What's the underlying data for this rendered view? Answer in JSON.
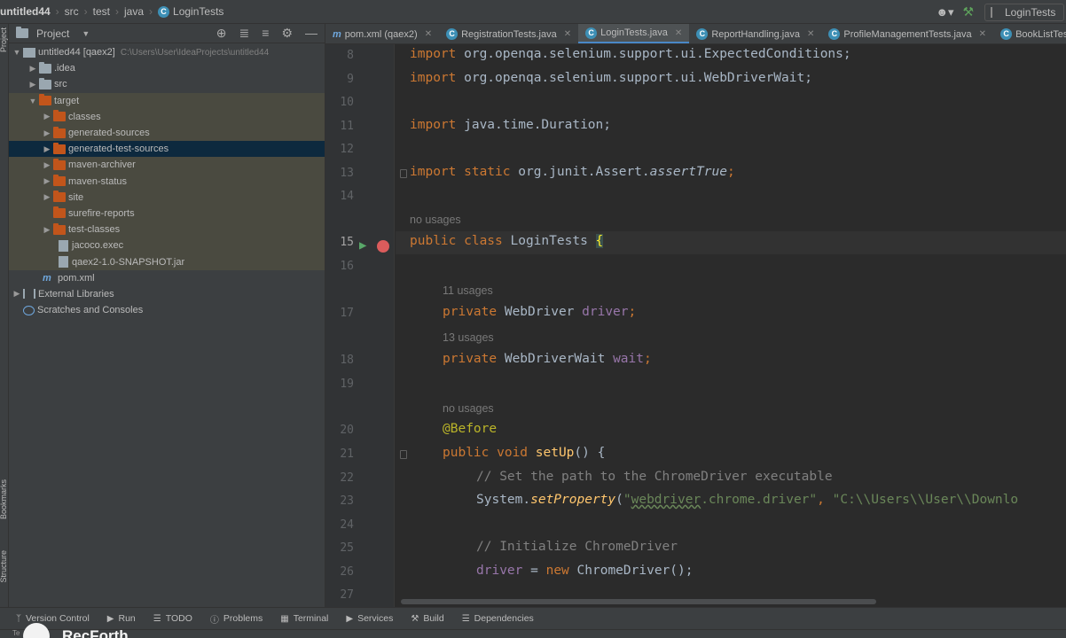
{
  "navbar": {
    "breadcrumbs": [
      "untitled44",
      "src",
      "test",
      "java",
      "LoginTests"
    ],
    "run_config": "LoginTests"
  },
  "toolstrip": {
    "top_label": "Project",
    "mid_label": "Bookmarks",
    "low_label": "Structure"
  },
  "project_panel": {
    "title": "Project",
    "tree": [
      {
        "label": "untitled44 [qaex2]",
        "note": "C:\\Users\\User\\IdeaProjects\\untitled44"
      },
      {
        "label": ".idea"
      },
      {
        "label": "src"
      },
      {
        "label": "target"
      },
      {
        "label": "classes"
      },
      {
        "label": "generated-sources"
      },
      {
        "label": "generated-test-sources"
      },
      {
        "label": "maven-archiver"
      },
      {
        "label": "maven-status"
      },
      {
        "label": "site"
      },
      {
        "label": "surefire-reports"
      },
      {
        "label": "test-classes"
      },
      {
        "label": "jacoco.exec"
      },
      {
        "label": "qaex2-1.0-SNAPSHOT.jar"
      },
      {
        "label": "pom.xml"
      },
      {
        "label": "External Libraries"
      },
      {
        "label": "Scratches and Consoles"
      }
    ]
  },
  "tabs": [
    {
      "label": "pom.xml (qaex2)"
    },
    {
      "label": "RegistrationTests.java"
    },
    {
      "label": "LoginTests.java"
    },
    {
      "label": "ReportHandling.java"
    },
    {
      "label": "ProfileManagementTests.java"
    },
    {
      "label": "BookListTests.java"
    }
  ],
  "editor": {
    "lines": {
      "n8": "8",
      "n9": "9",
      "n10": "10",
      "n11": "11",
      "n12": "12",
      "n13": "13",
      "n14": "14",
      "n15": "15",
      "n16": "16",
      "n17": "17",
      "n18": "18",
      "n19": "19",
      "n20": "20",
      "n21": "21",
      "n22": "22",
      "n23": "23",
      "n24": "24",
      "n25": "25",
      "n26": "26",
      "n27": "27"
    },
    "hints": {
      "class_usages": "no usages",
      "driver_usages": "11 usages",
      "wait_usages": "13 usages",
      "setup_usages": "no usages"
    },
    "code": {
      "l8_kw": "import",
      "l8_rest": " org.openqa.selenium.support.ui.ExpectedConditions;",
      "l9_kw": "import",
      "l9_rest": " org.openqa.selenium.support.ui.WebDriverWait;",
      "l11_kw": "import",
      "l11_rest": " java.time.Duration;",
      "l13_kw": "import static",
      "l13_rest": " org.junit.Assert.",
      "l13_method": "assertTrue",
      "l13_end": ";",
      "l15_kw": "public class",
      "l15_name": " LoginTests ",
      "l15_brace": "{",
      "l17_kw": "private",
      "l17_type": " WebDriver ",
      "l17_field": "driver",
      "l17_end": ";",
      "l18_kw": "private",
      "l18_type": " WebDriverWait ",
      "l18_field": "wait",
      "l18_end": ";",
      "l20_ann": "@Before",
      "l21_kw": "public void",
      "l21_fn": " setUp",
      "l21_end": "() {",
      "l22_cmt": "// Set the path to the ChromeDriver executable",
      "l23_cls": "System.",
      "l23_fn": "setProperty",
      "l23_p1": "(",
      "l23_q1": "\"",
      "l23_s1": "webdriver",
      "l23_s2": ".chrome.driver\"",
      "l23_comma": ", ",
      "l23_s3": "\"C:\\\\Users\\\\User\\\\Downlo",
      "l25_cmt": "// Initialize ChromeDriver",
      "l26_field": "driver",
      "l26_eq": " = ",
      "l26_kw": "new",
      "l26_rest": " ChromeDriver();"
    }
  },
  "bottom_tools": [
    {
      "icon": "version-control-icon",
      "label": "Version Control"
    },
    {
      "icon": "run-icon",
      "label": "Run"
    },
    {
      "icon": "todo-icon",
      "label": "TODO"
    },
    {
      "icon": "problems-icon",
      "label": "Problems"
    },
    {
      "icon": "terminal-icon",
      "label": "Terminal"
    },
    {
      "icon": "services-icon",
      "label": "Services"
    },
    {
      "icon": "build-icon",
      "label": "Build"
    },
    {
      "icon": "dependencies-icon",
      "label": "Dependencies"
    }
  ],
  "watermark": {
    "text": "RecForth",
    "small": "Te"
  },
  "colors": {
    "keyword": "#cc7832",
    "field": "#9876aa",
    "method": "#ffc66d",
    "annotation": "#bbb529",
    "comment": "#808080",
    "string": "#6a8759",
    "breakpoint": "#db5c5c",
    "accent": "#4a88c7"
  }
}
